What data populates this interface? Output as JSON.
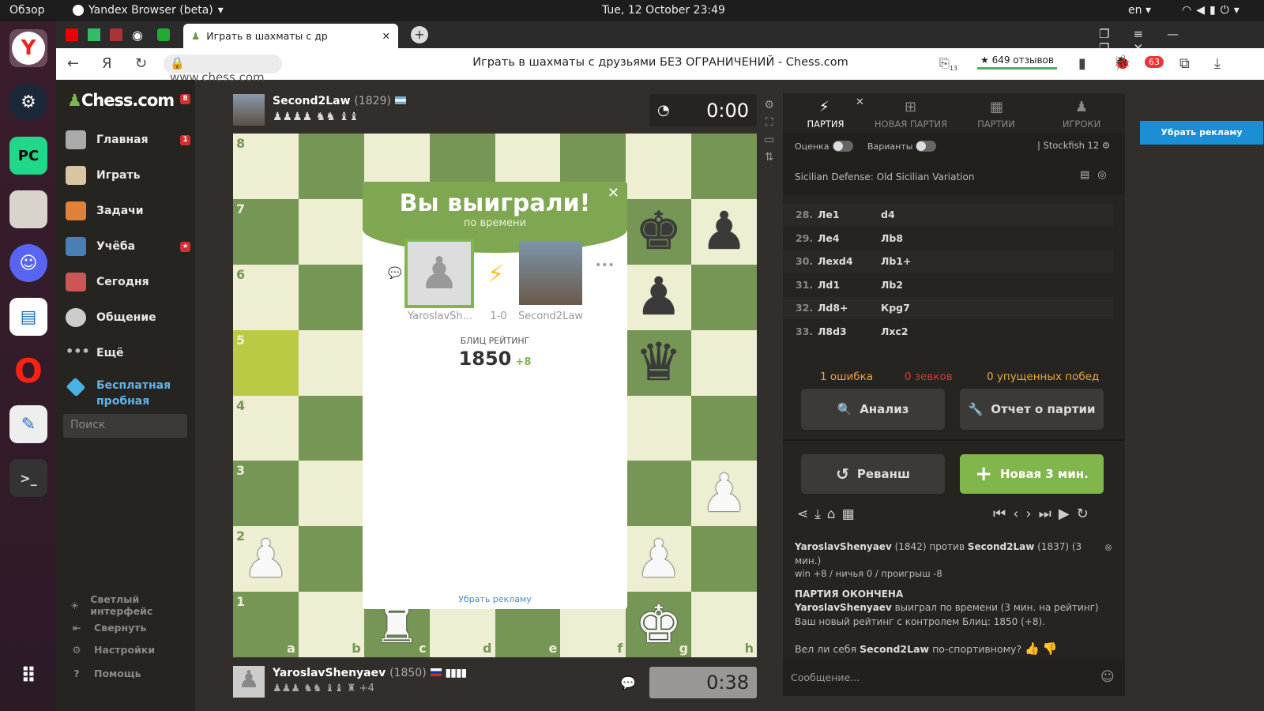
{
  "system": {
    "overview": "Обзор",
    "browser_app": "Yandex Browser (beta)",
    "datetime": "Tue, 12 October  23:49",
    "lang": "en"
  },
  "tabs": {
    "active_title": "Играть в шахматы с др"
  },
  "address": {
    "url": "www.chess.com",
    "page_title": "Играть в шахматы с друзьями БЕЗ ОГРАНИЧЕНИЙ - Chess.com",
    "reviews": "★ 649 отзывов",
    "badge_count": "13",
    "ext_count": "63"
  },
  "sidebar": {
    "logo": "Chess.com",
    "logo_badge": "8",
    "items": [
      {
        "label": "Главная",
        "badge": "1"
      },
      {
        "label": "Играть"
      },
      {
        "label": "Задачи"
      },
      {
        "label": "Учёба",
        "badge": "★"
      },
      {
        "label": "Сегодня"
      },
      {
        "label": "Общение"
      },
      {
        "label": "Ещё"
      }
    ],
    "promo": "Бесплатная пробная подписка",
    "search_placeholder": "Поиск",
    "footer": [
      {
        "label": "Светлый интерфейс"
      },
      {
        "label": "Свернуть"
      },
      {
        "label": "Настройки"
      },
      {
        "label": "Помощь"
      }
    ]
  },
  "opponent": {
    "name": "Second2Law",
    "rating": "(1829)",
    "clock": "0:00",
    "captured": "♟♟♟♟ ♞♞ ♝♝"
  },
  "player": {
    "name": "YaroslavShenyaev",
    "rating": "(1850)",
    "clock": "0:38",
    "captured": "♟♟♟ ♞♞ ♝♝ ♜ +4"
  },
  "board": {
    "ranks": [
      "8",
      "7",
      "6",
      "5",
      "4",
      "3",
      "2",
      "1"
    ],
    "files": [
      "a",
      "b",
      "c",
      "d",
      "e",
      "f",
      "g",
      "h"
    ]
  },
  "modal": {
    "title": "Вы выиграли!",
    "subtitle": "по времени",
    "winner_name": "YaroslavSh...",
    "score": "1-0",
    "loser_name": "Second2Law",
    "rating_label": "БЛИЦ РЕЙТИНГ",
    "rating": "1850",
    "rating_delta": "+8",
    "remove_ads": "Убрать рекламу"
  },
  "panel": {
    "tabs": [
      "ПАРТИЯ",
      "НОВАЯ ПАРТИЯ",
      "ПАРТИИ",
      "ИГРОКИ"
    ],
    "eval_label": "Оценка",
    "variants_label": "Варианты",
    "engine": "Stockfish 12",
    "opening": "Sicilian Defense: Old Sicilian Variation",
    "moves": [
      {
        "n": "28.",
        "w": "Ле1",
        "b": "d4"
      },
      {
        "n": "29.",
        "w": "Ле4",
        "b": "Лb8"
      },
      {
        "n": "30.",
        "w": "Лexd4",
        "b": "Лb1+"
      },
      {
        "n": "31.",
        "w": "Лd1",
        "b": "Лb2"
      },
      {
        "n": "32.",
        "w": "Лd8+",
        "b": "Крg7"
      },
      {
        "n": "33.",
        "w": "Л8d3",
        "b": "Лxc2"
      }
    ],
    "errors": "1 ошибка",
    "blunders": "0 зевков",
    "missed": "0 упущенных побед",
    "analysis": "Анализ",
    "report": "Отчет о партии",
    "rematch": "Реванш",
    "new_game": "Новая 3 мин.",
    "result": {
      "p1": "YaroslavShenyaev",
      "p1r": "(1842)",
      "vs": "против",
      "p2": "Second2Law",
      "p2r": "(1837)",
      "time": "(3 мин.)",
      "stats": "win +8 / ничья 0 / проигрыш -8",
      "over": "ПАРТИЯ ОКОНЧЕНА",
      "won_line": "выиграл по времени (3 мин. на рейтинг)",
      "new_rating": "Ваш новый рейтинг с контролем Блиц: 1850 (+8).",
      "sport_pre": "Вел ли себя",
      "sport_post": "по-спортивному?"
    },
    "message_placeholder": "Сообщение..."
  },
  "ad": {
    "remove": "Убрать рекламу"
  }
}
